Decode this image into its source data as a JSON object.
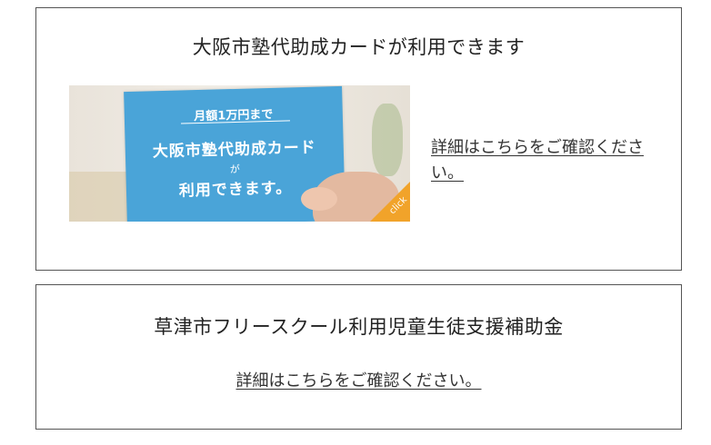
{
  "sections": [
    {
      "title": "大阪市塾代助成カードが利用できます",
      "banner": {
        "line_top": "月額1万円まで",
        "line_main": "大阪市塾代助成カード",
        "line_mid": "が",
        "line_bottom": "利用できます。",
        "click_label": "click",
        "accent_color": "#4aa4d8",
        "corner_color": "#f1a32a"
      },
      "link_text": "詳細はこちらをご確認ください。"
    },
    {
      "title": "草津市フリースクール利用児童生徒支援補助金",
      "link_text": "詳細はこちらをご確認ください。"
    }
  ]
}
